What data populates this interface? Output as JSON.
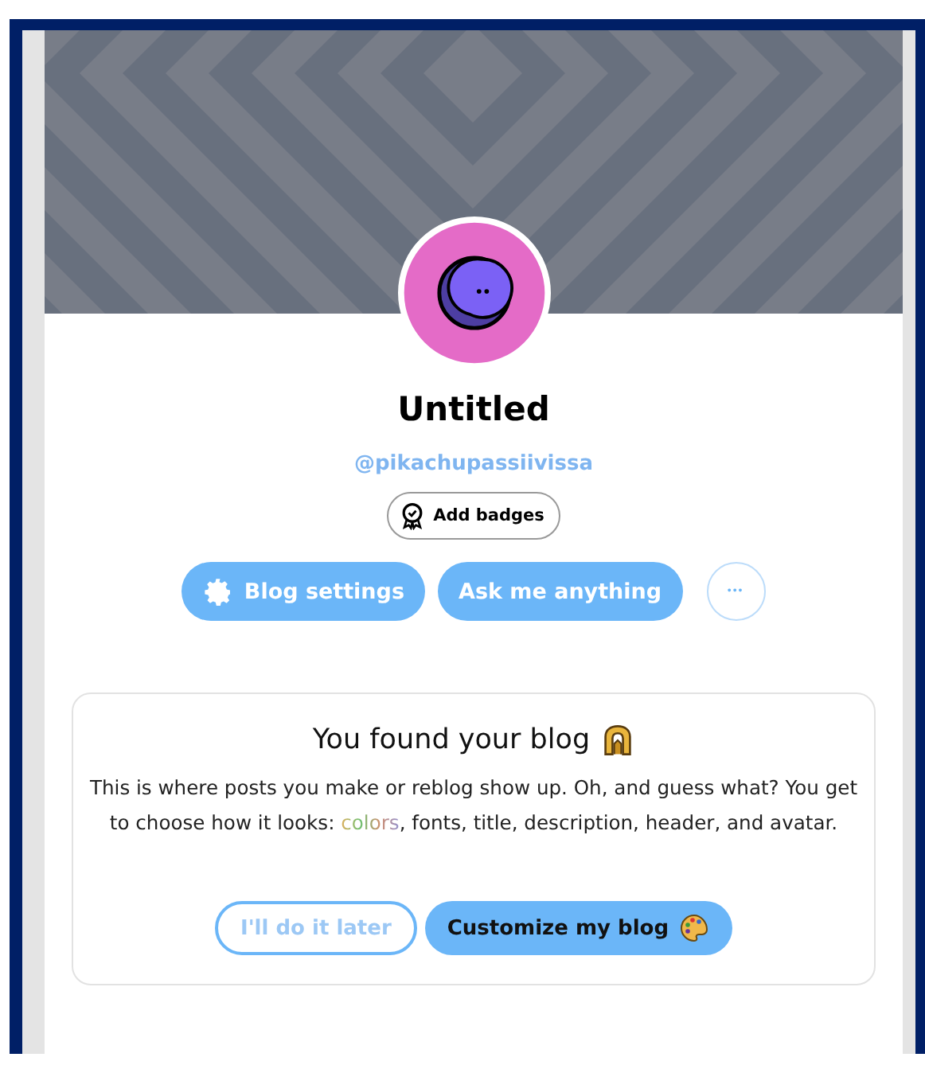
{
  "blog": {
    "title": "Untitled",
    "handle": "@pikachupassiivissa"
  },
  "badge_button": {
    "label": "Add badges"
  },
  "actions": [
    {
      "kind": "settings",
      "label": "Blog settings"
    },
    {
      "kind": "plain",
      "label": "Ask me anything"
    },
    {
      "kind": "more",
      "label": "•••"
    }
  ],
  "welcome_card": {
    "title": "You found your blog",
    "description": [
      {
        "kind": "plain",
        "text": "This is where posts you make or reblog show up. Oh, and guess what? You get to choose how it looks: "
      },
      {
        "kind": "rainbow",
        "text": "colors"
      },
      {
        "kind": "plain",
        "text": ", fonts, title, description, header, and avatar."
      }
    ],
    "buttons": [
      {
        "kind": "outline",
        "label": "I'll do it later"
      },
      {
        "kind": "filled",
        "label": "Customize my blog"
      }
    ]
  }
}
